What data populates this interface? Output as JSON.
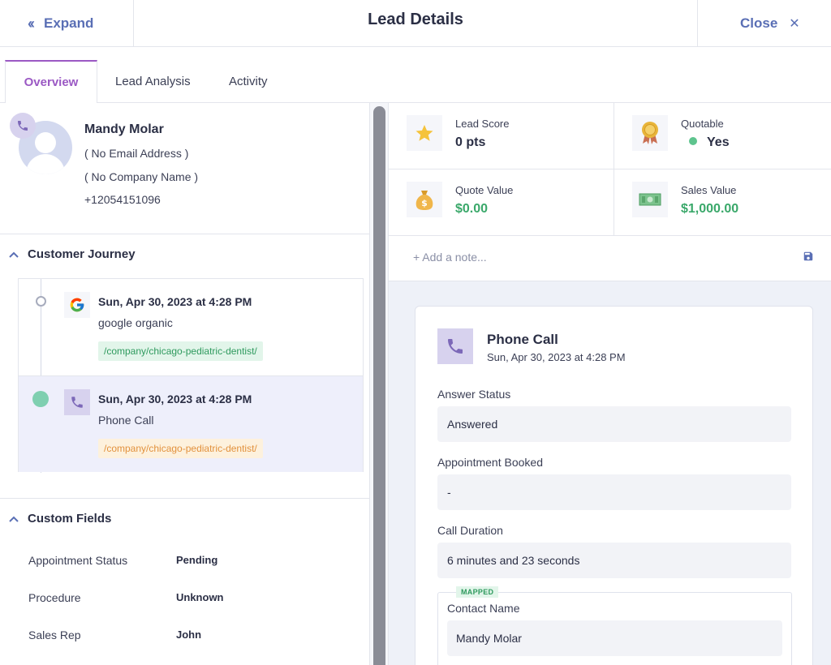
{
  "header": {
    "expand_label": "Expand",
    "title": "Lead Details",
    "close_label": "Close"
  },
  "tabs": [
    {
      "label": "Overview",
      "active": true
    },
    {
      "label": "Lead Analysis",
      "active": false
    },
    {
      "label": "Activity",
      "active": false
    }
  ],
  "contact": {
    "name": "Mandy Molar",
    "email": "( No Email Address )",
    "company": "( No Company Name )",
    "phone": "+12054151096"
  },
  "customer_journey": {
    "title": "Customer Journey",
    "items": [
      {
        "icon": "google-icon",
        "date": "Sun, Apr 30, 2023 at 4:28 PM",
        "source": "google organic",
        "path": "/company/chicago-pediatric-dentist/"
      },
      {
        "icon": "phone-icon",
        "date": "Sun, Apr 30, 2023 at 4:28 PM",
        "source": "Phone Call",
        "path": "/company/chicago-pediatric-dentist/"
      }
    ]
  },
  "custom_fields": {
    "title": "Custom Fields",
    "items": [
      {
        "label": "Appointment Status",
        "value": "Pending"
      },
      {
        "label": "Procedure",
        "value": "Unknown"
      },
      {
        "label": "Sales Rep",
        "value": "John"
      }
    ]
  },
  "stats": {
    "lead_score": {
      "label": "Lead Score",
      "value": "0 pts"
    },
    "quotable": {
      "label": "Quotable",
      "value": "Yes"
    },
    "quote_value": {
      "label": "Quote Value",
      "value": "$0.00"
    },
    "sales_value": {
      "label": "Sales Value",
      "value": "$1,000.00"
    }
  },
  "note": {
    "placeholder": "+ Add a note..."
  },
  "call_card": {
    "title": "Phone Call",
    "subtitle": "Sun, Apr 30, 2023 at 4:28 PM",
    "fields": [
      {
        "label": "Answer Status",
        "value": "Answered"
      },
      {
        "label": "Appointment Booked",
        "value": "-"
      },
      {
        "label": "Call Duration",
        "value": "6 minutes and 23 seconds"
      }
    ],
    "mapped": {
      "tag": "MAPPED",
      "label": "Contact Name",
      "value": "Mandy Molar"
    }
  },
  "colors": {
    "accent_blue": "#5a6fb5",
    "accent_purple": "#9b59c4",
    "green": "#3aa86a",
    "orange": "#e2913d"
  }
}
